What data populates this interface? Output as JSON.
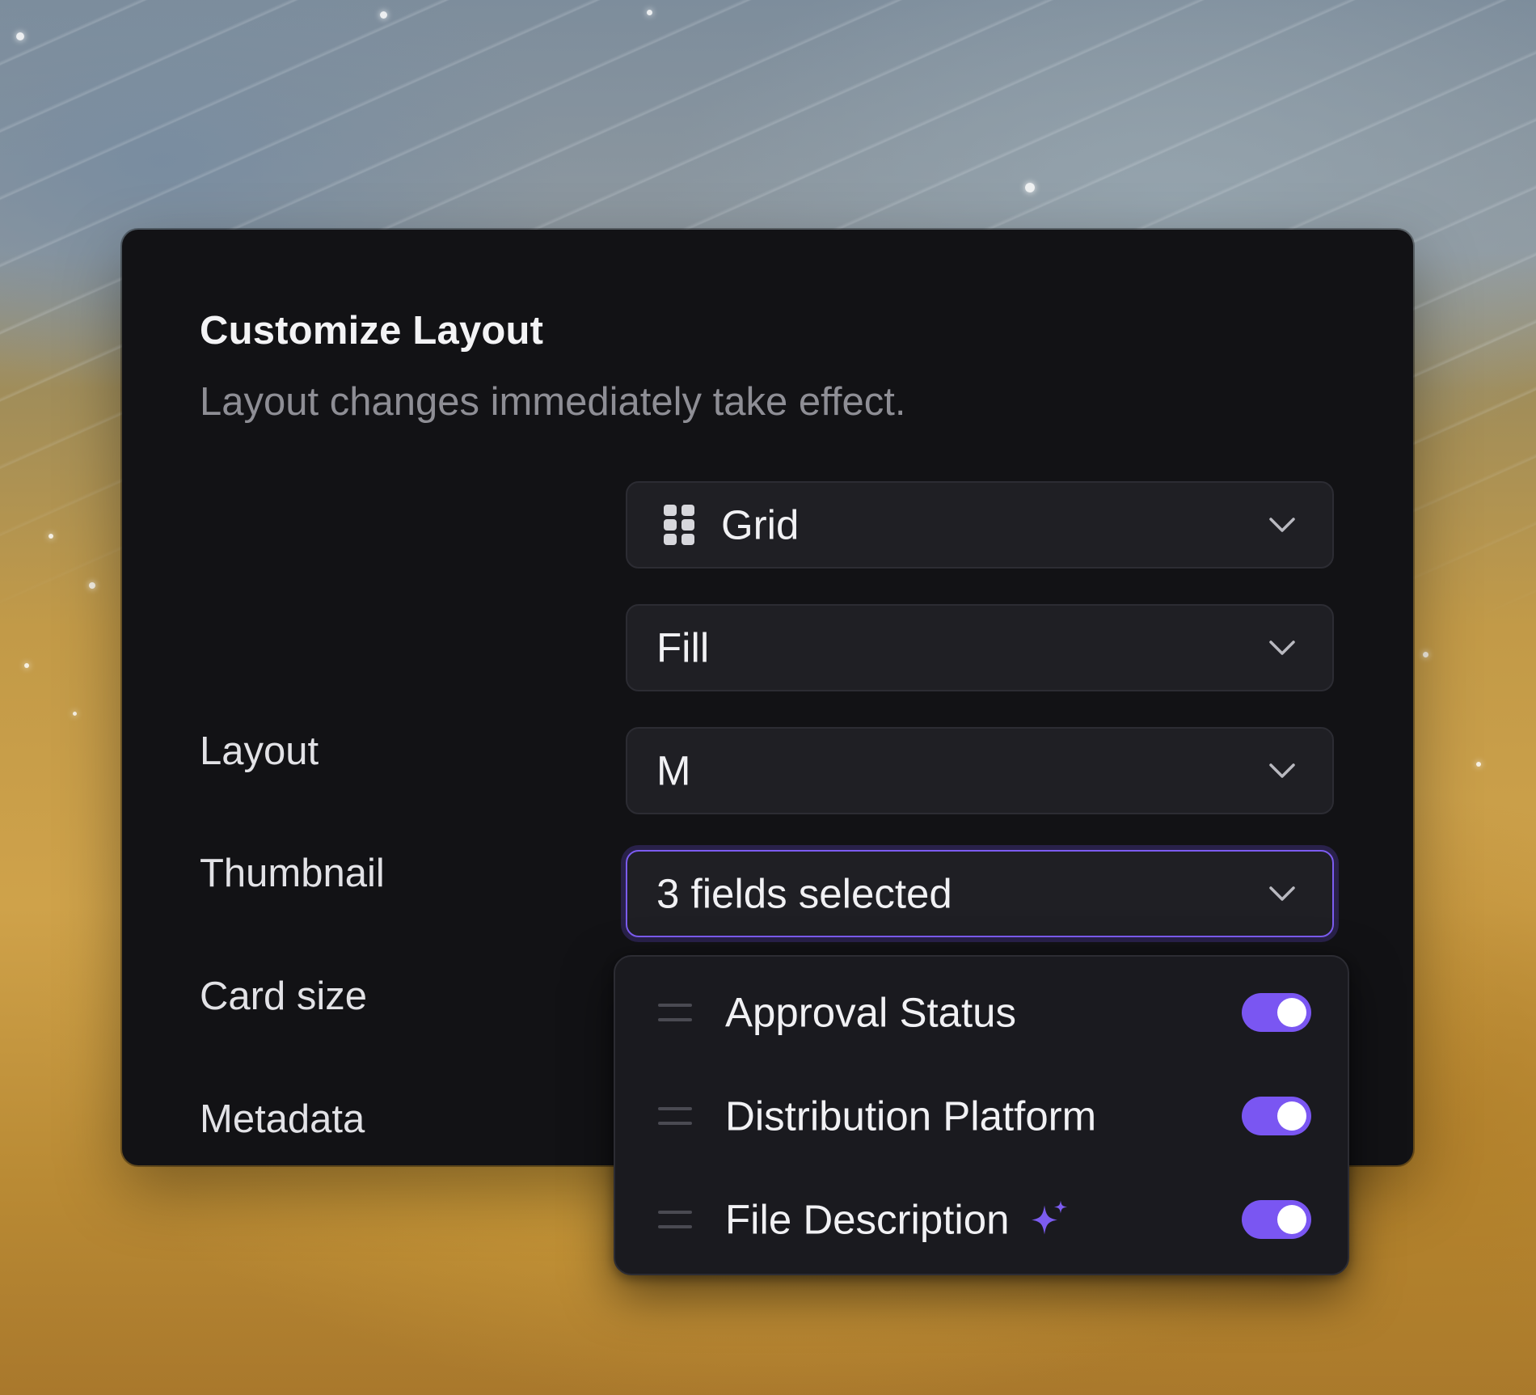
{
  "panel": {
    "title": "Customize Layout",
    "subtitle": "Layout changes immediately take effect."
  },
  "settings": [
    {
      "label": "Layout",
      "value": "Grid",
      "icon": "grid-icon"
    },
    {
      "label": "Thumbnail",
      "value": "Fill"
    },
    {
      "label": "Card size",
      "value": "M"
    },
    {
      "label": "Metadata",
      "value": "3 fields selected",
      "focused": true
    }
  ],
  "metadata_dropdown": {
    "items": [
      {
        "label": "Approval Status",
        "enabled": true
      },
      {
        "label": "Distribution Platform",
        "enabled": true
      },
      {
        "label": "File Description",
        "enabled": true,
        "icon": "sparkle-icon"
      }
    ]
  },
  "colors": {
    "panel_bg": "#121215",
    "field_bg": "#1f1f24",
    "accent": "#7a56f2",
    "text_primary": "#f1f1f4",
    "text_secondary": "#8e8e95"
  }
}
